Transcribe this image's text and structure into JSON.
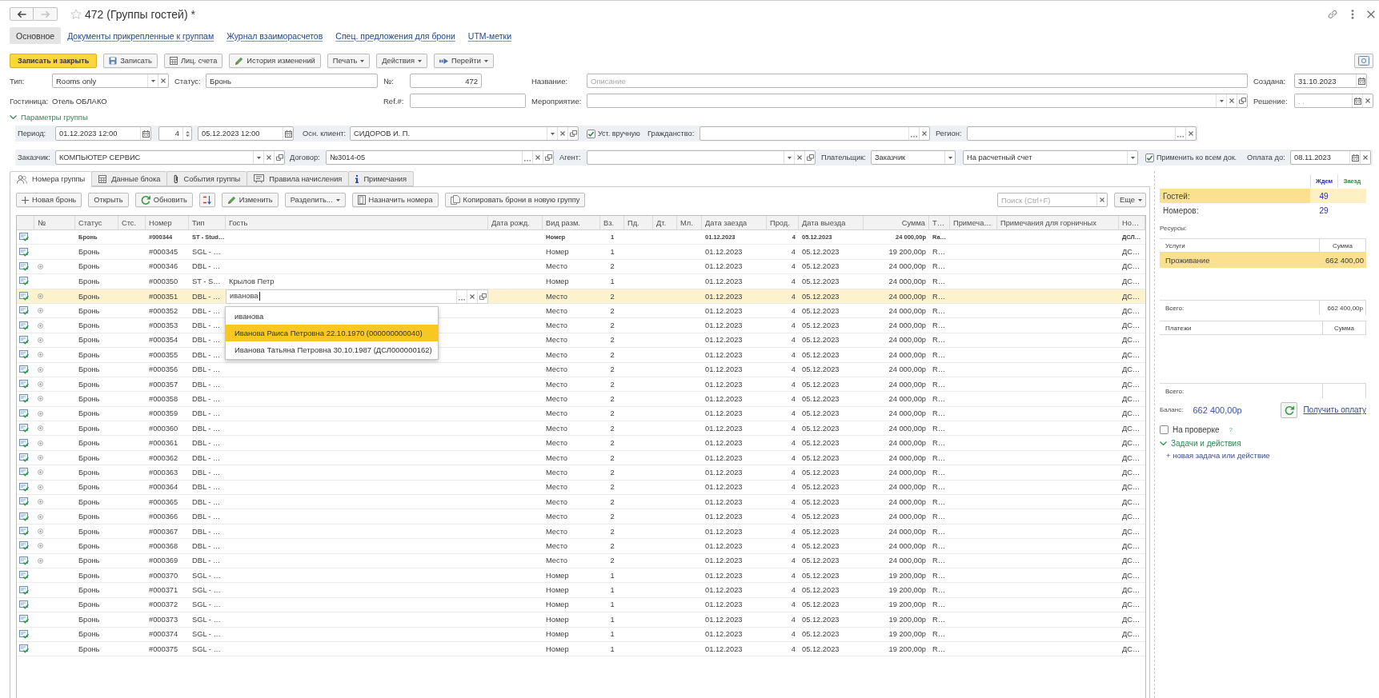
{
  "window": {
    "title": "472 (Группы гостей) *",
    "favorite": false,
    "forward_disabled": true
  },
  "nav": [
    {
      "label": "Основное",
      "selected": true
    },
    {
      "label": "Документы прикрепленные к группам",
      "selected": false
    },
    {
      "label": "Журнал взаиморасчетов",
      "selected": false
    },
    {
      "label": "Спец. предложения для брони",
      "selected": false
    },
    {
      "label": "UTM-метки",
      "selected": false
    }
  ],
  "toolbar": [
    {
      "label": "Записать и закрыть",
      "kind": "primary"
    },
    {
      "label": "Записать",
      "kind": "save"
    },
    {
      "label": "Лиц. счета",
      "kind": "accounts"
    },
    {
      "label": "История изменений",
      "kind": "history"
    },
    {
      "label": "Печать",
      "kind": "menu"
    },
    {
      "label": "Действия",
      "kind": "menu"
    },
    {
      "label": "Перейти",
      "kind": "goto"
    }
  ],
  "main_fields": [
    {
      "label": "Тип:",
      "kind": "combo",
      "value": "Rooms only"
    },
    {
      "label": "Статус:",
      "kind": "plain",
      "value": "Бронь"
    },
    {
      "label": "№:",
      "kind": "number",
      "value": "472"
    },
    {
      "label": "Название:",
      "kind": "plain",
      "placeholder": "Описание"
    },
    {
      "label": "Создана:",
      "kind": "date",
      "value": "31.10.2023"
    },
    {
      "label": "Гостиница:",
      "kind": "text",
      "value": "Отель ОБЛАКО"
    },
    {
      "label": "Ref.#:",
      "kind": "plain"
    },
    {
      "label": "Мероприятие:",
      "kind": "link"
    },
    {
      "label": "Решение:",
      "kind": "dateclear",
      "placeholder": ". ."
    }
  ],
  "group_params": {
    "title": "Параметры группы",
    "expanded": true,
    "bands": [
      {
        "fields": [
          {
            "kind": "date",
            "label": "Период:",
            "value": "01.12.2023 12:00"
          },
          {
            "kind": "spin",
            "value": "4"
          },
          {
            "kind": "date",
            "value": "05.12.2023 12:00"
          },
          {
            "kind": "link",
            "label": "Осн. клиент:",
            "value": "СИДОРОВ И. П."
          },
          {
            "kind": "checkbox",
            "label": "Уст. вручную",
            "checked": true
          },
          {
            "kind": "lookup",
            "label": "Гражданство:"
          },
          {
            "kind": "lookup",
            "label": "Регион:"
          }
        ]
      },
      {
        "fields": [
          {
            "kind": "link",
            "label": "Заказчик:",
            "value": "КОМПЬЮТЕР СЕРВИС"
          },
          {
            "kind": "pick",
            "label": "Договор:",
            "value": "№3014-05"
          },
          {
            "kind": "link",
            "label": "Агент:"
          },
          {
            "kind": "list",
            "label": "Плательщик:",
            "value": "Заказчик"
          },
          {
            "kind": "list",
            "value": "На расчетный счет"
          },
          {
            "kind": "checkbox",
            "label": "Применить ко всем док.",
            "checked": true
          },
          {
            "kind": "dateclear",
            "label": "Оплата до:",
            "value": "08.11.2023"
          }
        ]
      }
    ]
  },
  "tabs": [
    {
      "label": "Номера группы",
      "kind": "guests",
      "selected": true
    },
    {
      "label": "Данные блока",
      "kind": "block",
      "selected": false
    },
    {
      "label": "События группы",
      "kind": "events",
      "selected": false
    },
    {
      "label": "Правила начисления",
      "kind": "rules",
      "selected": false
    },
    {
      "label": "Примечания",
      "kind": "notes",
      "selected": false
    }
  ],
  "table_toolbar": [
    {
      "label": "Новая бронь",
      "kind": "add"
    },
    {
      "label": "Открыть",
      "kind": "plain"
    },
    {
      "label": "Обновить",
      "kind": "refresh"
    },
    {
      "kind": "sort"
    },
    {
      "label": "Изменить",
      "kind": "edit"
    },
    {
      "label": "Разделить...",
      "kind": "menu"
    },
    {
      "label": "Назначить номера",
      "kind": "assign"
    },
    {
      "label": "Копировать брони в новую группу",
      "kind": "copy"
    }
  ],
  "search": {
    "placeholder": "Поиск (Ctrl+F)"
  },
  "more_button": "Еще",
  "table": {
    "columns": [
      "№",
      "Статус",
      "Стс.",
      "Номер",
      "Тип",
      "Гость",
      "Дата рожд.",
      "Вид разм.",
      "Вз.",
      "Пд.",
      "Дт.",
      "Мл.",
      "Дата заезда",
      "Прод.",
      "Дата выезда",
      "Сумма",
      "Т…",
      "Примеча…",
      "Примечания для горничных",
      "Но…"
    ],
    "rows": [
      {
        "kind": "group",
        "selected": false,
        "editing": false,
        "plus_mark": false,
        "status": "Бронь",
        "number": "#000344",
        "type": "ST - Stud…",
        "place": "Номер",
        "adults": "1",
        "arrival": "01.12.2023",
        "nights": "4",
        "departure": "05.12.2023",
        "amount": "24 000,00р",
        "column_17": "Ra…",
        "column_20": "ДСЛ…"
      },
      {
        "kind": "booking",
        "selected": false,
        "editing": false,
        "plus_mark": false,
        "status": "Бронь",
        "number": "#000345",
        "type": "SGL - …",
        "place": "Номер",
        "adults": "1",
        "arrival": "01.12.2023",
        "nights": "4",
        "departure": "05.12.2023",
        "amount": "19 200,00р",
        "column_17": "R…",
        "column_20": "ДС…"
      },
      {
        "kind": "booking",
        "selected": false,
        "editing": false,
        "plus_mark": true,
        "status": "Бронь",
        "number": "#000346",
        "type": "DBL - …",
        "place": "Место",
        "adults": "2",
        "arrival": "01.12.2023",
        "nights": "4",
        "departure": "05.12.2023",
        "amount": "24 000,00р",
        "column_17": "R…",
        "column_20": "ДС…"
      },
      {
        "kind": "booking",
        "selected": false,
        "editing": false,
        "plus_mark": false,
        "status": "Бронь",
        "number": "#000350",
        "type": "ST - S…",
        "guest": "Крылов Петр",
        "place": "Номер",
        "adults": "1",
        "arrival": "01.12.2023",
        "nights": "4",
        "departure": "05.12.2023",
        "amount": "24 000,00р",
        "column_17": "R…",
        "column_20": "ДС…"
      },
      {
        "kind": "booking",
        "selected": true,
        "editing": true,
        "plus_mark": true,
        "status": "Бронь",
        "number": "#000351",
        "type": "DBL - …",
        "guest": "иванова",
        "place": "Место",
        "adults": "2",
        "arrival": "01.12.2023",
        "nights": "4",
        "departure": "05.12.2023",
        "amount": "24 000,00р",
        "column_17": "R…",
        "column_20": "ДС…",
        "suggestions": [
          {
            "text": "иванова",
            "selected": false
          },
          {
            "text": "Иванова Раиса Петровна 22.10.1970 (000000000040)",
            "selected": true
          },
          {
            "text": "Иванова Татьяна Петровна 30.10.1987 (ДСЛ000000162)",
            "selected": false
          }
        ]
      },
      {
        "kind": "booking",
        "selected": false,
        "editing": false,
        "plus_mark": true,
        "status": "Бронь",
        "number": "#000352",
        "type": "DBL - …",
        "place": "Место",
        "adults": "2",
        "arrival": "01.12.2023",
        "nights": "4",
        "departure": "05.12.2023",
        "amount": "24 000,00р",
        "column_17": "R…",
        "column_20": "ДС…"
      },
      {
        "kind": "booking",
        "selected": false,
        "editing": false,
        "plus_mark": true,
        "status": "Бронь",
        "number": "#000353",
        "type": "DBL - …",
        "place": "Место",
        "adults": "2",
        "arrival": "01.12.2023",
        "nights": "4",
        "departure": "05.12.2023",
        "amount": "24 000,00р",
        "column_17": "R…",
        "column_20": "ДС…"
      },
      {
        "kind": "booking",
        "selected": false,
        "editing": false,
        "plus_mark": true,
        "status": "Бронь",
        "number": "#000354",
        "type": "DBL - …",
        "place": "Место",
        "adults": "2",
        "arrival": "01.12.2023",
        "nights": "4",
        "departure": "05.12.2023",
        "amount": "24 000,00р",
        "column_17": "R…",
        "column_20": "ДС…"
      },
      {
        "kind": "booking",
        "selected": false,
        "editing": false,
        "plus_mark": true,
        "status": "Бронь",
        "number": "#000355",
        "type": "DBL - …",
        "place": "Место",
        "adults": "2",
        "arrival": "01.12.2023",
        "nights": "4",
        "departure": "05.12.2023",
        "amount": "24 000,00р",
        "column_17": "R…",
        "column_20": "ДС…"
      },
      {
        "kind": "booking",
        "selected": false,
        "editing": false,
        "plus_mark": true,
        "status": "Бронь",
        "number": "#000356",
        "type": "DBL - …",
        "place": "Место",
        "adults": "2",
        "arrival": "01.12.2023",
        "nights": "4",
        "departure": "05.12.2023",
        "amount": "24 000,00р",
        "column_17": "R…",
        "column_20": "ДС…"
      },
      {
        "kind": "booking",
        "selected": false,
        "editing": false,
        "plus_mark": true,
        "status": "Бронь",
        "number": "#000357",
        "type": "DBL - …",
        "place": "Место",
        "adults": "2",
        "arrival": "01.12.2023",
        "nights": "4",
        "departure": "05.12.2023",
        "amount": "24 000,00р",
        "column_17": "R…",
        "column_20": "ДС…"
      },
      {
        "kind": "booking",
        "selected": false,
        "editing": false,
        "plus_mark": true,
        "status": "Бронь",
        "number": "#000358",
        "type": "DBL - …",
        "place": "Место",
        "adults": "2",
        "arrival": "01.12.2023",
        "nights": "4",
        "departure": "05.12.2023",
        "amount": "24 000,00р",
        "column_17": "R…",
        "column_20": "ДС…"
      },
      {
        "kind": "booking",
        "selected": false,
        "editing": false,
        "plus_mark": true,
        "status": "Бронь",
        "number": "#000359",
        "type": "DBL - …",
        "place": "Место",
        "adults": "2",
        "arrival": "01.12.2023",
        "nights": "4",
        "departure": "05.12.2023",
        "amount": "24 000,00р",
        "column_17": "R…",
        "column_20": "ДС…"
      },
      {
        "kind": "booking",
        "selected": false,
        "editing": false,
        "plus_mark": true,
        "status": "Бронь",
        "number": "#000360",
        "type": "DBL - …",
        "place": "Место",
        "adults": "2",
        "arrival": "01.12.2023",
        "nights": "4",
        "departure": "05.12.2023",
        "amount": "24 000,00р",
        "column_17": "R…",
        "column_20": "ДС…"
      },
      {
        "kind": "booking",
        "selected": false,
        "editing": false,
        "plus_mark": true,
        "status": "Бронь",
        "number": "#000361",
        "type": "DBL - …",
        "place": "Место",
        "adults": "2",
        "arrival": "01.12.2023",
        "nights": "4",
        "departure": "05.12.2023",
        "amount": "24 000,00р",
        "column_17": "R…",
        "column_20": "ДС…"
      },
      {
        "kind": "booking",
        "selected": false,
        "editing": false,
        "plus_mark": true,
        "status": "Бронь",
        "number": "#000362",
        "type": "DBL - …",
        "place": "Место",
        "adults": "2",
        "arrival": "01.12.2023",
        "nights": "4",
        "departure": "05.12.2023",
        "amount": "24 000,00р",
        "column_17": "R…",
        "column_20": "ДС…"
      },
      {
        "kind": "booking",
        "selected": false,
        "editing": false,
        "plus_mark": true,
        "status": "Бронь",
        "number": "#000363",
        "type": "DBL - …",
        "place": "Место",
        "adults": "2",
        "arrival": "01.12.2023",
        "nights": "4",
        "departure": "05.12.2023",
        "amount": "24 000,00р",
        "column_17": "R…",
        "column_20": "ДС…"
      },
      {
        "kind": "booking",
        "selected": false,
        "editing": false,
        "plus_mark": true,
        "status": "Бронь",
        "number": "#000364",
        "type": "DBL - …",
        "place": "Место",
        "adults": "2",
        "arrival": "01.12.2023",
        "nights": "4",
        "departure": "05.12.2023",
        "amount": "24 000,00р",
        "column_17": "R…",
        "column_20": "ДС…"
      },
      {
        "kind": "booking",
        "selected": false,
        "editing": false,
        "plus_mark": true,
        "status": "Бронь",
        "number": "#000365",
        "type": "DBL - …",
        "place": "Место",
        "adults": "2",
        "arrival": "01.12.2023",
        "nights": "4",
        "departure": "05.12.2023",
        "amount": "24 000,00р",
        "column_17": "R…",
        "column_20": "ДС…"
      },
      {
        "kind": "booking",
        "selected": false,
        "editing": false,
        "plus_mark": true,
        "status": "Бронь",
        "number": "#000366",
        "type": "DBL - …",
        "place": "Место",
        "adults": "2",
        "arrival": "01.12.2023",
        "nights": "4",
        "departure": "05.12.2023",
        "amount": "24 000,00р",
        "column_17": "R…",
        "column_20": "ДС…"
      },
      {
        "kind": "booking",
        "selected": false,
        "editing": false,
        "plus_mark": true,
        "status": "Бронь",
        "number": "#000367",
        "type": "DBL - …",
        "place": "Место",
        "adults": "2",
        "arrival": "01.12.2023",
        "nights": "4",
        "departure": "05.12.2023",
        "amount": "24 000,00р",
        "column_17": "R…",
        "column_20": "ДС…"
      },
      {
        "kind": "booking",
        "selected": false,
        "editing": false,
        "plus_mark": true,
        "status": "Бронь",
        "number": "#000368",
        "type": "DBL - …",
        "place": "Место",
        "adults": "2",
        "arrival": "01.12.2023",
        "nights": "4",
        "departure": "05.12.2023",
        "amount": "24 000,00р",
        "column_17": "R…",
        "column_20": "ДС…"
      },
      {
        "kind": "booking",
        "selected": false,
        "editing": false,
        "plus_mark": true,
        "status": "Бронь",
        "number": "#000369",
        "type": "DBL - …",
        "place": "Место",
        "adults": "2",
        "arrival": "01.12.2023",
        "nights": "4",
        "departure": "05.12.2023",
        "amount": "24 000,00р",
        "column_17": "R…",
        "column_20": "ДС…"
      },
      {
        "kind": "booking",
        "selected": false,
        "editing": false,
        "plus_mark": false,
        "status": "Бронь",
        "number": "#000370",
        "type": "SGL - …",
        "place": "Номер",
        "adults": "1",
        "arrival": "01.12.2023",
        "nights": "4",
        "departure": "05.12.2023",
        "amount": "19 200,00р",
        "column_17": "R…",
        "column_20": "ДС…"
      },
      {
        "kind": "booking",
        "selected": false,
        "editing": false,
        "plus_mark": false,
        "status": "Бронь",
        "number": "#000371",
        "type": "SGL - …",
        "place": "Номер",
        "adults": "1",
        "arrival": "01.12.2023",
        "nights": "4",
        "departure": "05.12.2023",
        "amount": "19 200,00р",
        "column_17": "R…",
        "column_20": "ДС…"
      },
      {
        "kind": "booking",
        "selected": false,
        "editing": false,
        "plus_mark": false,
        "status": "Бронь",
        "number": "#000372",
        "type": "SGL - …",
        "place": "Номер",
        "adults": "1",
        "arrival": "01.12.2023",
        "nights": "4",
        "departure": "05.12.2023",
        "amount": "19 200,00р",
        "column_17": "R…",
        "column_20": "ДС…"
      },
      {
        "kind": "booking",
        "selected": false,
        "editing": false,
        "plus_mark": false,
        "status": "Бронь",
        "number": "#000373",
        "type": "SGL - …",
        "place": "Номер",
        "adults": "1",
        "arrival": "01.12.2023",
        "nights": "4",
        "departure": "05.12.2023",
        "amount": "19 200,00р",
        "column_17": "R…",
        "column_20": "ДС…"
      },
      {
        "kind": "booking",
        "selected": false,
        "editing": false,
        "plus_mark": false,
        "status": "Бронь",
        "number": "#000374",
        "type": "SGL - …",
        "place": "Номер",
        "adults": "1",
        "arrival": "01.12.2023",
        "nights": "4",
        "departure": "05.12.2023",
        "amount": "19 200,00р",
        "column_17": "R…",
        "column_20": "ДС…"
      },
      {
        "kind": "booking",
        "selected": false,
        "editing": false,
        "plus_mark": false,
        "status": "Бронь",
        "number": "#000375",
        "type": "SGL - …",
        "place": "Номер",
        "adults": "1",
        "arrival": "01.12.2023",
        "nights": "4",
        "departure": "05.12.2023",
        "amount": "19 200,00р",
        "column_17": "R…",
        "column_20": "ДС…"
      }
    ]
  },
  "summary": {
    "columns": [
      {
        "label": "Ждем",
        "color": "#2b2bb0"
      },
      {
        "label": "Заезд",
        "color": "#2e8b3e"
      }
    ],
    "rows": [
      {
        "label": "Гостей:",
        "values": [
          "49"
        ],
        "selected": true
      },
      {
        "label": "Номеров:",
        "values": [
          "29"
        ],
        "selected": false
      }
    ]
  },
  "resources": {
    "title": "Ресурсы:",
    "columns": [
      "Услуги",
      "Сумма"
    ],
    "rows": [
      {
        "service": "Проживание",
        "amount": "662 400,00",
        "selected": true
      }
    ],
    "total_label": "Всего:",
    "total": "662 400,00р"
  },
  "payments": {
    "columns": [
      "Платежи",
      "Сумма"
    ],
    "total_label": "Всего:"
  },
  "balance": {
    "label": "Баланс:",
    "value": "662 400,00р",
    "link": "Получить оплату"
  },
  "review": {
    "label": "На проверке",
    "checked": false,
    "help": "?"
  },
  "tasks": {
    "title": "Задачи и действия",
    "expanded": true,
    "new_task": "+ новая задача или действие"
  }
}
